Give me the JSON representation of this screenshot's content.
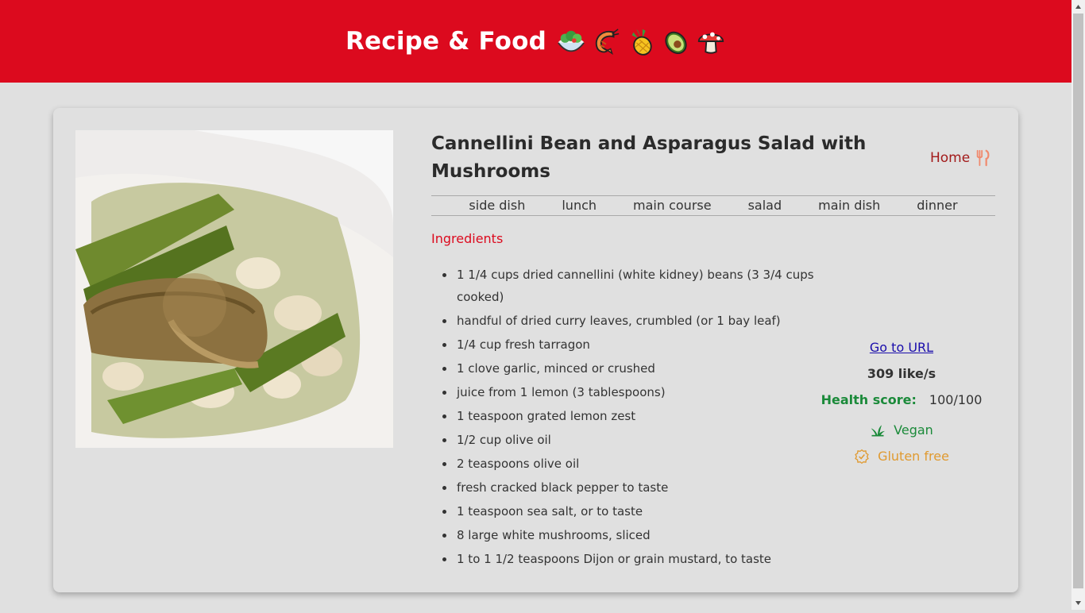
{
  "header": {
    "title": "Recipe & Food",
    "emoji_icons": [
      "salad-icon",
      "shrimp-icon",
      "pineapple-icon",
      "avocado-icon",
      "mushroom-icon"
    ]
  },
  "colors": {
    "brand_red": "#dc0a1e",
    "page_bg": "#e0e0e0",
    "health_green": "#1b8a3a",
    "gluten_orange": "#e09a30",
    "home_link": "#a21a1a"
  },
  "recipe": {
    "title": "Cannellini Bean and Asparagus Salad with Mushrooms",
    "home_label": "Home",
    "tags": [
      "side dish",
      "lunch",
      "main course",
      "salad",
      "main dish",
      "dinner"
    ],
    "ingredients_heading": "Ingredients",
    "ingredients": [
      "1 1/4 cups dried cannellini (white kidney) beans (3 3/4 cups cooked)",
      "handful of dried curry leaves, crumbled (or 1 bay leaf)",
      "1/4 cup fresh tarragon",
      "1 clove garlic, minced or crushed",
      "juice from 1 lemon (3 tablespoons)",
      "1 teaspoon grated lemon zest",
      "1/2 cup olive oil",
      "2 teaspoons olive oil",
      "fresh cracked black pepper to taste",
      "1 teaspoon sea salt, or to taste",
      "8 large white mushrooms, sliced",
      "1 to 1 1/2 teaspoons Dijon or grain mustard, to taste"
    ],
    "url_label": "Go to URL",
    "likes": "309 like/s",
    "health_label": "Health score:",
    "health_value": "100/100",
    "diets": [
      {
        "label": "Vegan",
        "icon": "leaf-icon"
      },
      {
        "label": "Gluten free",
        "icon": "badge-check-icon"
      }
    ]
  }
}
